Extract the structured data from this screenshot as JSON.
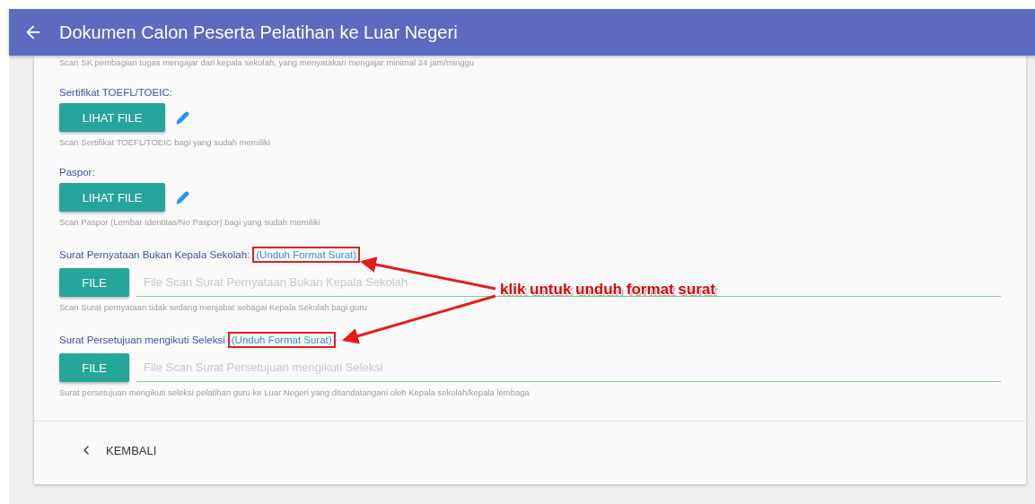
{
  "header": {
    "title": "Dokumen Calon Peserta Pelatihan ke Luar Negeri"
  },
  "top_hint": "Scan SK pembagian tugas mengajar dari kepala sekolah, yang menyatakan mengajar minimal 24 jam/minggu",
  "documents": [
    {
      "kind": "view",
      "label": "Sertifikat TOEFL/TOEIC:",
      "button": "LIHAT FILE",
      "hint": "Scan Sertifikat TOEFL/TOEIC bagi yang sudah memiliki"
    },
    {
      "kind": "view",
      "label": "Paspor:",
      "button": "LIHAT FILE",
      "hint": "Scan Paspor (Lembar Identitas/No Paspor) bagi yang sudah memiliki"
    },
    {
      "kind": "upload",
      "label": "Surat Pernyataan Bukan Kepala Sekolah:",
      "link": "(Unduh Format Surat)",
      "highlighted": true,
      "button": "FILE",
      "placeholder": "File Scan Surat Pernyataan Bukan Kepala Sekolah",
      "hint": "Scan Surat pernyataan tidak sedang menjabat sebagai Kepala Sekolah bagi guru"
    },
    {
      "kind": "upload",
      "label": "Surat Persetujuan mengikuti Seleksi",
      "link": "(Unduh Format Surat)",
      "highlighted": true,
      "button": "FILE",
      "placeholder": "File Scan Surat Persetujuan mengikuti Seleksi",
      "hint": "Surat persetujuan mengikuti seleksi pelatihan guru ke Luar Negeri yang ditandatangani oleh Kepala sekolah/kepala lembaga"
    }
  ],
  "back_button": {
    "label": "KEMBALI"
  },
  "annotation": {
    "text": "klik untuk unduh format surat"
  }
}
